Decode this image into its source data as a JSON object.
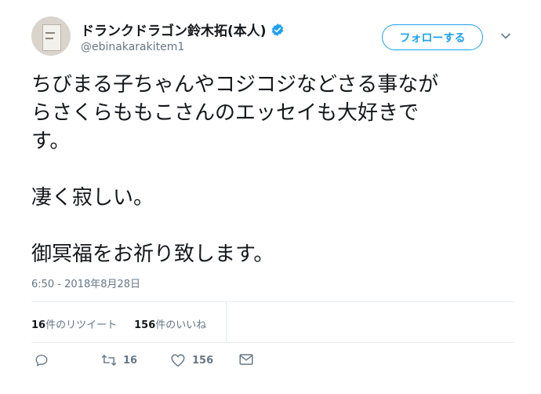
{
  "profile": {
    "name": "ドランクドラゴン鈴木拓(本人)",
    "handle": "@ebinakarakitem1",
    "verified_icon": "verified-badge-icon"
  },
  "follow_button": {
    "label": "フォローする"
  },
  "tweet": {
    "lines": [
      "ちびまる子ちゃんやコジコジなどさる事なが",
      "らさくらももこさんのエッセイも大好きで",
      "す。",
      "凄く寂しい。",
      "御冥福をお祈り致します。"
    ]
  },
  "timestamp": "6:50 - 2018年8月28日",
  "stats": {
    "retweet_count": "16",
    "retweet_label": "件のリツイート",
    "like_count": "156",
    "like_label": "件のいいね"
  },
  "actions": {
    "reply_icon": "reply-icon",
    "retweet_icon": "retweet-icon",
    "retweet_count": "16",
    "like_icon": "heart-icon",
    "like_count": "156",
    "dm_icon": "envelope-icon"
  },
  "colors": {
    "accent": "#1da1f2",
    "secondary_text": "#657786",
    "divider": "#e6ecf0"
  }
}
